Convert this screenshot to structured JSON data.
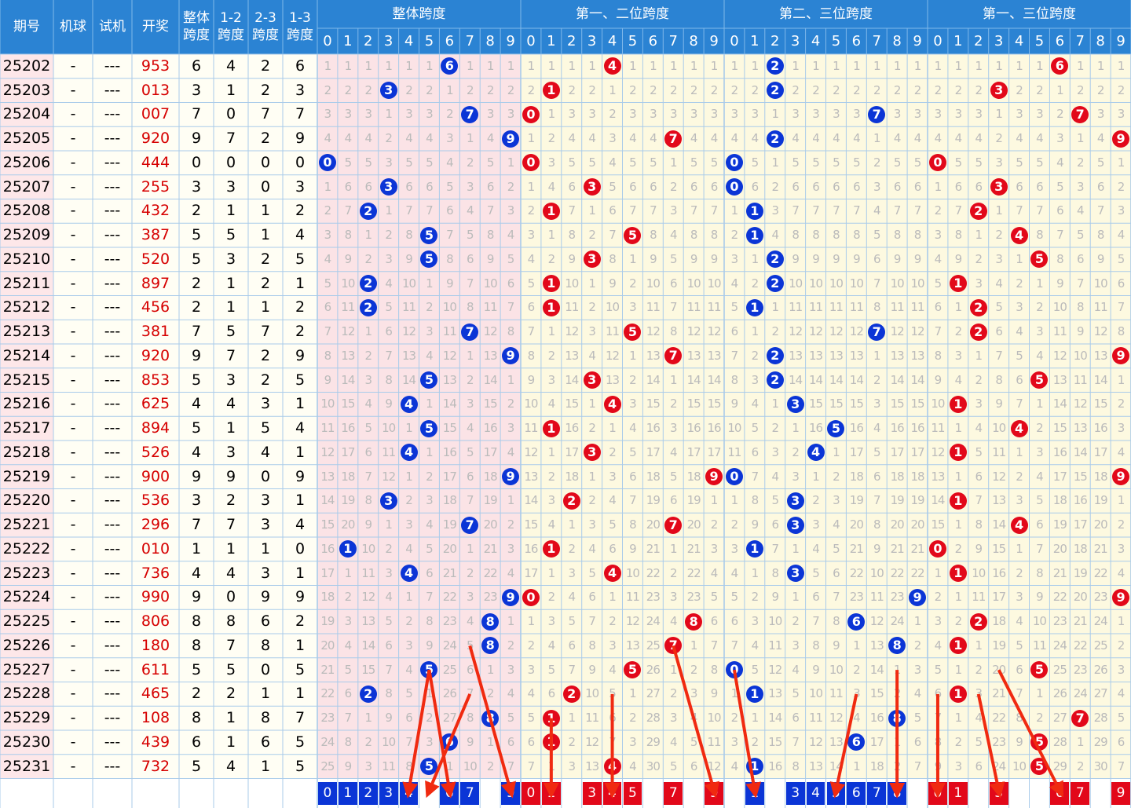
{
  "headers": {
    "period": "期号",
    "machine": "机球",
    "trial": "试机",
    "draw": "开奖",
    "total_span": [
      "整体",
      "跨度"
    ],
    "span12": [
      "1-2",
      "跨度"
    ],
    "span23": [
      "2-3",
      "跨度"
    ],
    "span13": [
      "1-3",
      "跨度"
    ],
    "groups": [
      "整体跨度",
      "第一、二位跨度",
      "第二、三位跨度",
      "第一、三位跨度"
    ]
  },
  "digits": [
    "0",
    "1",
    "2",
    "3",
    "4",
    "5",
    "6",
    "7",
    "8",
    "9"
  ],
  "colors": {
    "header_bg": "#2b83d3",
    "header_line": "#7fb8ea",
    "grid_line": "#a9cbea",
    "period_bg": "#fde7e9",
    "draw_text": "#d60000",
    "group_blue_bg": "#fbe3e6",
    "group_red_bg": "#fdf9e0",
    "blue_ball": "#0b35d6",
    "red_ball": "#e2081a",
    "arrow": "#f02a10"
  },
  "chart_data": {
    "type": "table",
    "columns": [
      "期号",
      "机球",
      "试机",
      "开奖",
      "整体跨度",
      "1-2跨度",
      "2-3跨度",
      "1-3跨度"
    ],
    "rows": [
      {
        "period": "25202",
        "machine": "-",
        "trial": "---",
        "draw": "953",
        "total": 6,
        "s12": 4,
        "s23": 2,
        "s13": 6
      },
      {
        "period": "25203",
        "machine": "-",
        "trial": "---",
        "draw": "013",
        "total": 3,
        "s12": 1,
        "s23": 2,
        "s13": 3
      },
      {
        "period": "25204",
        "machine": "-",
        "trial": "---",
        "draw": "007",
        "total": 7,
        "s12": 0,
        "s23": 7,
        "s13": 7
      },
      {
        "period": "25205",
        "machine": "-",
        "trial": "---",
        "draw": "920",
        "total": 9,
        "s12": 7,
        "s23": 2,
        "s13": 9
      },
      {
        "period": "25206",
        "machine": "-",
        "trial": "---",
        "draw": "444",
        "total": 0,
        "s12": 0,
        "s23": 0,
        "s13": 0
      },
      {
        "period": "25207",
        "machine": "-",
        "trial": "---",
        "draw": "255",
        "total": 3,
        "s12": 3,
        "s23": 0,
        "s13": 3
      },
      {
        "period": "25208",
        "machine": "-",
        "trial": "---",
        "draw": "432",
        "total": 2,
        "s12": 1,
        "s23": 1,
        "s13": 2
      },
      {
        "period": "25209",
        "machine": "-",
        "trial": "---",
        "draw": "387",
        "total": 5,
        "s12": 5,
        "s23": 1,
        "s13": 4
      },
      {
        "period": "25210",
        "machine": "-",
        "trial": "---",
        "draw": "520",
        "total": 5,
        "s12": 3,
        "s23": 2,
        "s13": 5
      },
      {
        "period": "25211",
        "machine": "-",
        "trial": "---",
        "draw": "897",
        "total": 2,
        "s12": 1,
        "s23": 2,
        "s13": 1
      },
      {
        "period": "25212",
        "machine": "-",
        "trial": "---",
        "draw": "456",
        "total": 2,
        "s12": 1,
        "s23": 1,
        "s13": 2
      },
      {
        "period": "25213",
        "machine": "-",
        "trial": "---",
        "draw": "381",
        "total": 7,
        "s12": 5,
        "s23": 7,
        "s13": 2
      },
      {
        "period": "25214",
        "machine": "-",
        "trial": "---",
        "draw": "920",
        "total": 9,
        "s12": 7,
        "s23": 2,
        "s13": 9
      },
      {
        "period": "25215",
        "machine": "-",
        "trial": "---",
        "draw": "853",
        "total": 5,
        "s12": 3,
        "s23": 2,
        "s13": 5
      },
      {
        "period": "25216",
        "machine": "-",
        "trial": "---",
        "draw": "625",
        "total": 4,
        "s12": 4,
        "s23": 3,
        "s13": 1
      },
      {
        "period": "25217",
        "machine": "-",
        "trial": "---",
        "draw": "894",
        "total": 5,
        "s12": 1,
        "s23": 5,
        "s13": 4
      },
      {
        "period": "25218",
        "machine": "-",
        "trial": "---",
        "draw": "526",
        "total": 4,
        "s12": 3,
        "s23": 4,
        "s13": 1
      },
      {
        "period": "25219",
        "machine": "-",
        "trial": "---",
        "draw": "900",
        "total": 9,
        "s12": 9,
        "s23": 0,
        "s13": 9
      },
      {
        "period": "25220",
        "machine": "-",
        "trial": "---",
        "draw": "536",
        "total": 3,
        "s12": 2,
        "s23": 3,
        "s13": 1
      },
      {
        "period": "25221",
        "machine": "-",
        "trial": "---",
        "draw": "296",
        "total": 7,
        "s12": 7,
        "s23": 3,
        "s13": 4
      },
      {
        "period": "25222",
        "machine": "-",
        "trial": "---",
        "draw": "010",
        "total": 1,
        "s12": 1,
        "s23": 1,
        "s13": 0
      },
      {
        "period": "25223",
        "machine": "-",
        "trial": "---",
        "draw": "736",
        "total": 4,
        "s12": 4,
        "s23": 3,
        "s13": 1
      },
      {
        "period": "25224",
        "machine": "-",
        "trial": "---",
        "draw": "990",
        "total": 9,
        "s12": 0,
        "s23": 9,
        "s13": 9
      },
      {
        "period": "25225",
        "machine": "-",
        "trial": "---",
        "draw": "806",
        "total": 8,
        "s12": 8,
        "s23": 6,
        "s13": 2
      },
      {
        "period": "25226",
        "machine": "-",
        "trial": "---",
        "draw": "180",
        "total": 8,
        "s12": 7,
        "s23": 8,
        "s13": 1
      },
      {
        "period": "25227",
        "machine": "-",
        "trial": "---",
        "draw": "611",
        "total": 5,
        "s12": 5,
        "s23": 0,
        "s13": 5
      },
      {
        "period": "25228",
        "machine": "-",
        "trial": "---",
        "draw": "465",
        "total": 2,
        "s12": 2,
        "s23": 1,
        "s13": 1
      },
      {
        "period": "25229",
        "machine": "-",
        "trial": "---",
        "draw": "108",
        "total": 8,
        "s12": 1,
        "s23": 8,
        "s13": 7
      },
      {
        "period": "25230",
        "machine": "-",
        "trial": "---",
        "draw": "439",
        "total": 6,
        "s12": 1,
        "s23": 6,
        "s13": 5
      },
      {
        "period": "25231",
        "machine": "-",
        "trial": "---",
        "draw": "732",
        "total": 5,
        "s12": 4,
        "s23": 1,
        "s13": 5
      }
    ],
    "predictions": {
      "total": [
        0,
        1,
        2,
        3,
        4,
        6,
        7,
        9
      ],
      "s12": [
        0,
        1,
        3,
        4,
        5,
        7,
        9
      ],
      "s23": [
        1,
        3,
        4,
        5,
        6,
        7,
        8
      ],
      "s13": [
        0,
        1,
        3,
        6,
        7,
        9
      ]
    },
    "annotation_arrows": [
      {
        "group": "total",
        "from": [
          25227,
          5
        ],
        "to": [
          25232,
          4
        ]
      },
      {
        "group": "total",
        "from": [
          25227,
          5
        ],
        "to": [
          25232,
          6
        ]
      },
      {
        "group": "total",
        "from": [
          25228,
          7
        ],
        "to": [
          25232,
          5
        ]
      },
      {
        "group": "total",
        "from": [
          25226,
          7
        ],
        "to": [
          25232,
          9
        ]
      },
      {
        "group": "s12",
        "from": [
          25229,
          1
        ],
        "to": [
          25232,
          1
        ]
      },
      {
        "group": "s12",
        "from": [
          25228,
          4
        ],
        "to": [
          25232,
          4
        ]
      },
      {
        "group": "s12",
        "from": [
          25226,
          7
        ],
        "to": [
          25232,
          9
        ]
      },
      {
        "group": "s23",
        "from": [
          25227,
          0
        ],
        "to": [
          25232,
          1
        ]
      },
      {
        "group": "s23",
        "from": [
          25228,
          6
        ],
        "to": [
          25232,
          5
        ]
      },
      {
        "group": "s23",
        "from": [
          25227,
          8
        ],
        "to": [
          25232,
          8
        ]
      },
      {
        "group": "s13",
        "from": [
          25228,
          0
        ],
        "to": [
          25232,
          0
        ]
      },
      {
        "group": "s13",
        "from": [
          25228,
          2
        ],
        "to": [
          25232,
          3
        ]
      },
      {
        "group": "s13",
        "from": [
          25227,
          3
        ],
        "to": [
          25232,
          6
        ]
      }
    ]
  }
}
